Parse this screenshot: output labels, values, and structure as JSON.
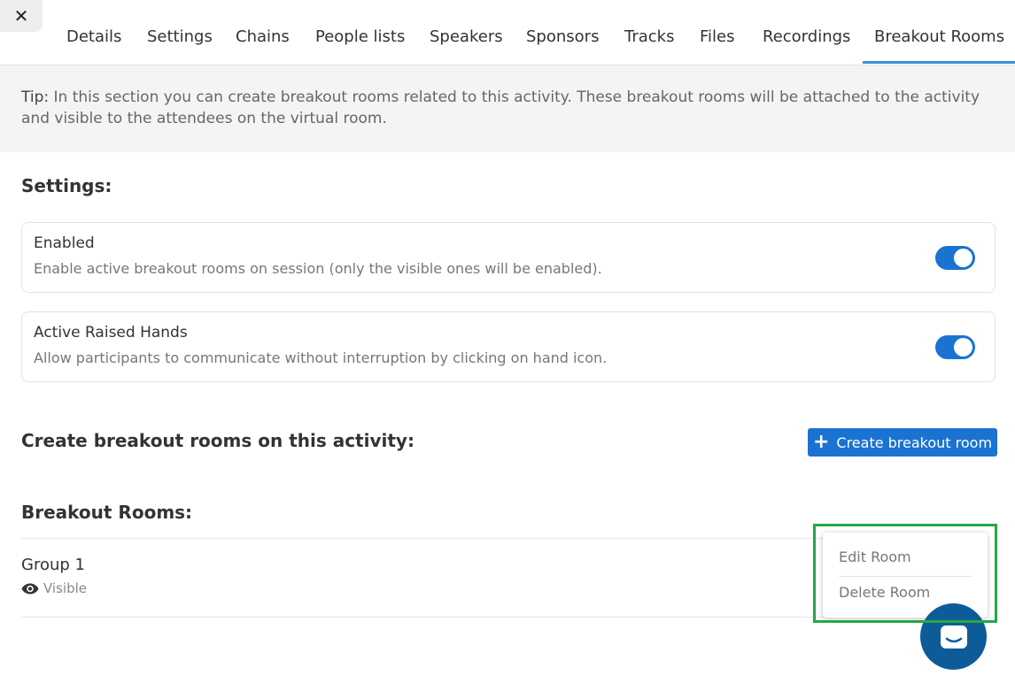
{
  "close_icon": "close-icon",
  "tabs": [
    {
      "label": "Details"
    },
    {
      "label": "Settings"
    },
    {
      "label": "Chains"
    },
    {
      "label": "People lists"
    },
    {
      "label": "Speakers"
    },
    {
      "label": "Sponsors"
    },
    {
      "label": "Tracks"
    },
    {
      "label": "Files"
    },
    {
      "label": "Recordings"
    },
    {
      "label": "Breakout Rooms",
      "active": true
    }
  ],
  "tip": {
    "prefix": "Tip:",
    "text": " In this section you can create breakout rooms related to this activity. These breakout rooms will be attached to the activity and visible to the attendees on the virtual room."
  },
  "settings": {
    "heading": "Settings:",
    "items": [
      {
        "title": "Enabled",
        "description": "Enable active breakout rooms on session (only the visible ones will be enabled).",
        "on": true
      },
      {
        "title": "Active Raised Hands",
        "description": "Allow participants to communicate without interruption by clicking on hand icon.",
        "on": true
      }
    ]
  },
  "create": {
    "heading": "Create breakout rooms on this activity:",
    "button_label": "Create breakout room"
  },
  "rooms": {
    "heading": "Breakout Rooms:",
    "items": [
      {
        "name": "Group 1",
        "status": "Visible"
      }
    ]
  },
  "context_menu": {
    "edit": "Edit Room",
    "delete": "Delete Room"
  },
  "colors": {
    "accent": "#1a73d1",
    "highlight": "#26a743",
    "chat": "#0d5c99"
  }
}
